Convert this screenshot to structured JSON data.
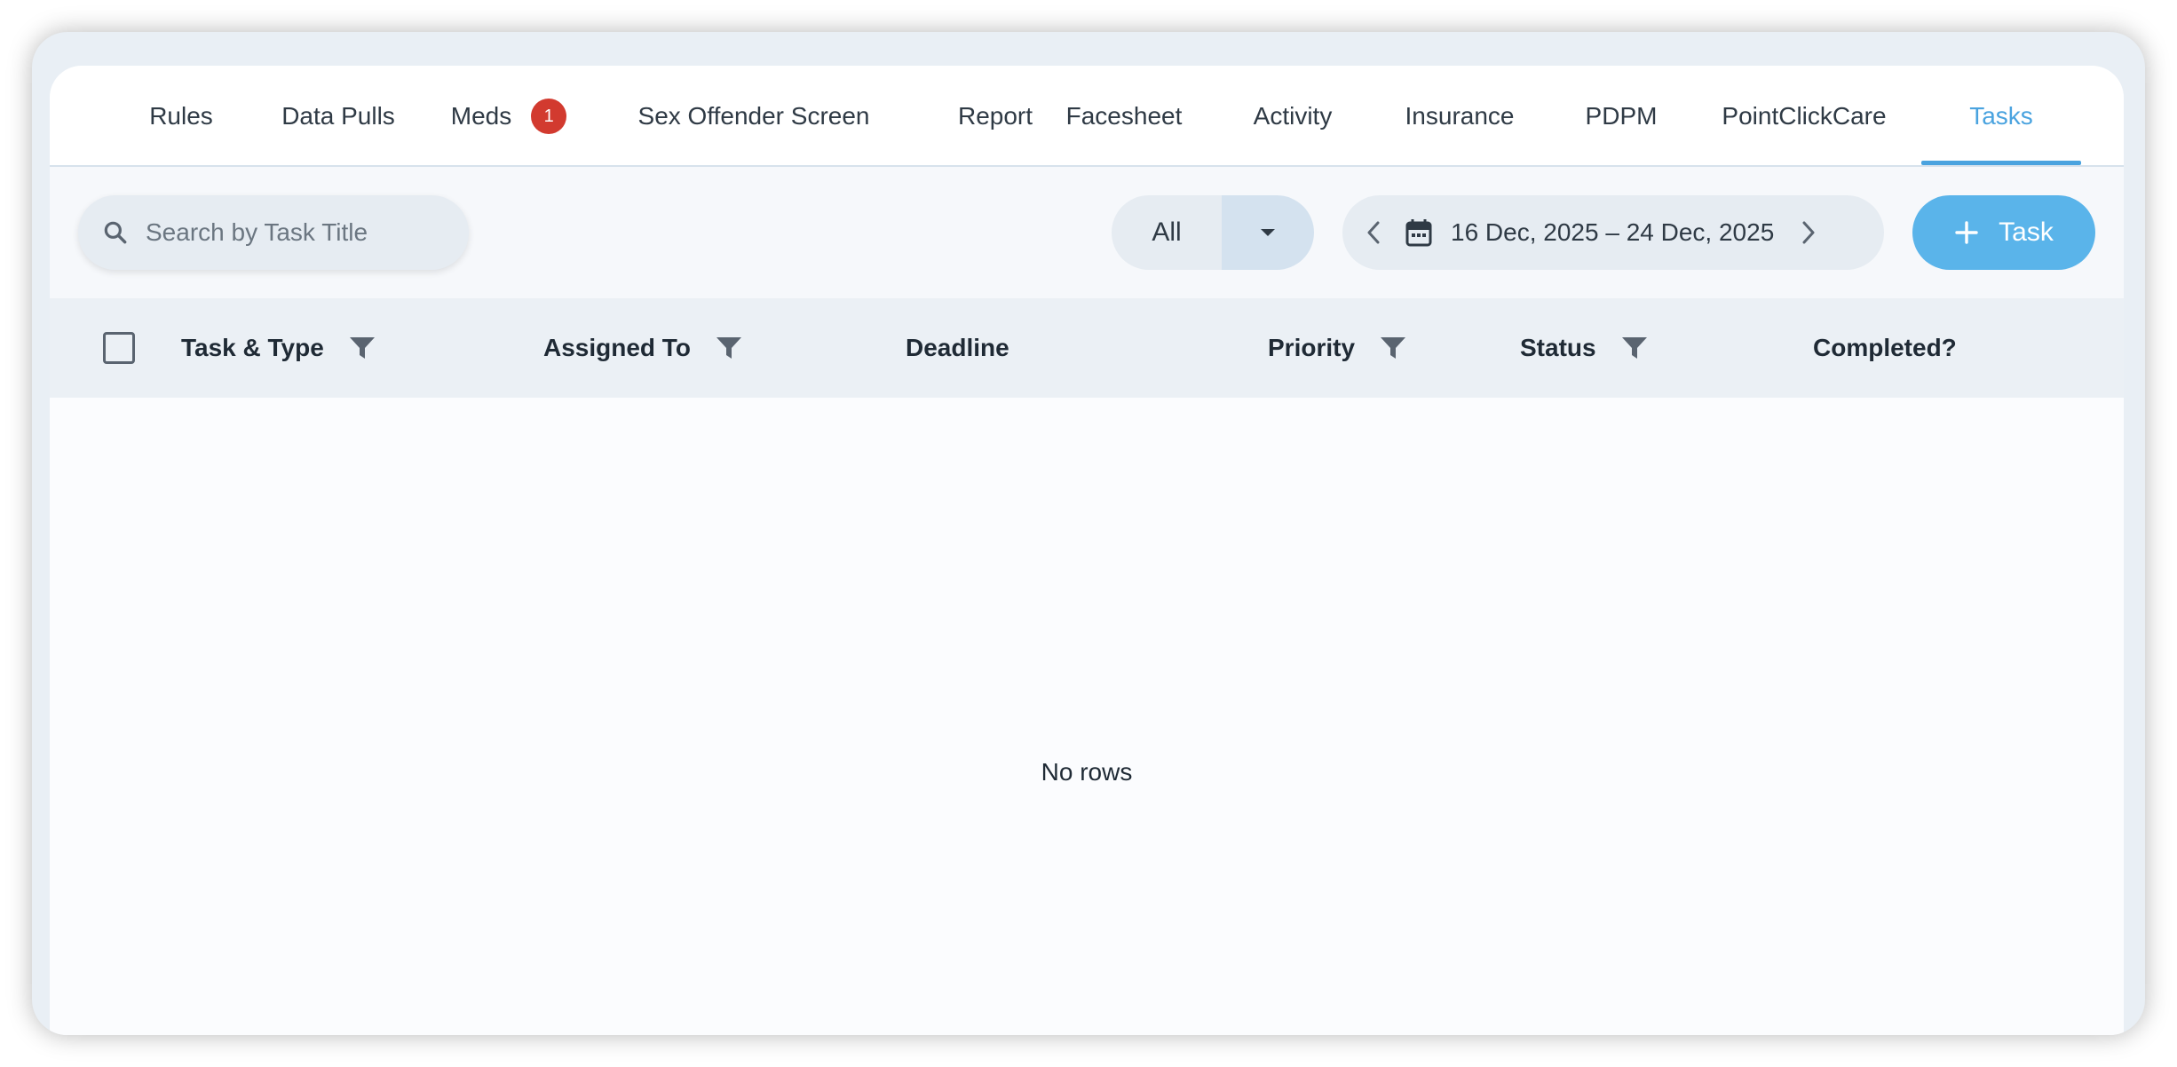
{
  "tabs": [
    {
      "label": "Rules"
    },
    {
      "label": "Data Pulls"
    },
    {
      "label": "Meds",
      "badge": "1"
    },
    {
      "label": "Sex Offender Screen"
    },
    {
      "label": "Report"
    },
    {
      "label": "Facesheet"
    },
    {
      "label": "Activity"
    },
    {
      "label": "Insurance"
    },
    {
      "label": "PDPM"
    },
    {
      "label": "PointClickCare"
    },
    {
      "label": "Tasks",
      "active": true
    }
  ],
  "toolbar": {
    "search_placeholder": "Search by Task Title",
    "filter_value": "All",
    "date_range": "16 Dec, 2025 – 24 Dec, 2025",
    "add_label": "Task"
  },
  "table": {
    "columns": [
      "Task & Type",
      "Assigned To",
      "Deadline",
      "Priority",
      "Status",
      "Completed?"
    ],
    "empty_text": "No rows"
  },
  "colors": {
    "accent": "#4aa3df",
    "button": "#5ab4ea",
    "badge": "#d23a2f"
  },
  "icons": {
    "search": "search-icon",
    "dropdown": "caret-down-icon",
    "prev": "chevron-left-icon",
    "next": "chevron-right-icon",
    "calendar": "calendar-icon",
    "add": "plus-icon",
    "filter": "filter-icon"
  }
}
